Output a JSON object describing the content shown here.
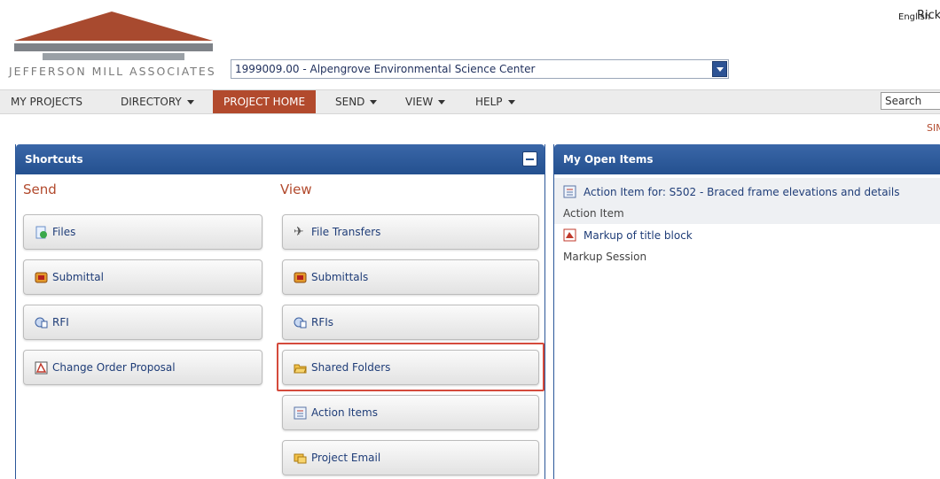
{
  "header": {
    "company_name": "JEFFERSON MILL ASSOCIATES",
    "language": "English",
    "user": "Rick",
    "project_selector": "1999009.00 - Alpengrove Environmental Science Center"
  },
  "nav": {
    "items": [
      {
        "label": "MY PROJECTS"
      },
      {
        "label": "DIRECTORY"
      },
      {
        "label": "PROJECT HOME"
      },
      {
        "label": "SEND"
      },
      {
        "label": "VIEW"
      },
      {
        "label": "HELP"
      }
    ],
    "search_value": "Search",
    "sim_link": "SIM"
  },
  "shortcuts": {
    "title": "Shortcuts",
    "send_heading": "Send",
    "view_heading": "View",
    "send_items": [
      {
        "label": "Files",
        "icon": "file-send-icon"
      },
      {
        "label": "Submittal",
        "icon": "submittal-icon"
      },
      {
        "label": "RFI",
        "icon": "rfi-icon"
      },
      {
        "label": "Change Order Proposal",
        "icon": "change-order-icon"
      }
    ],
    "view_items": [
      {
        "label": "File Transfers",
        "icon": "satellite-icon"
      },
      {
        "label": "Submittals",
        "icon": "submittal-icon"
      },
      {
        "label": "RFIs",
        "icon": "rfi-icon"
      },
      {
        "label": "Shared Folders",
        "icon": "folder-icon"
      },
      {
        "label": "Action Items",
        "icon": "action-item-icon"
      },
      {
        "label": "Project Email",
        "icon": "email-icon"
      }
    ]
  },
  "open_items": {
    "title": "My Open Items",
    "items": [
      {
        "link": "Action Item for: S502 - Braced frame elevations and details",
        "type": "Action Item",
        "icon": "action-item-icon"
      },
      {
        "link": "Markup of title block",
        "type": "Markup Session",
        "icon": "markup-icon"
      }
    ]
  },
  "colors": {
    "brand_red": "#b24a2d",
    "panel_blue": "#2b5799",
    "highlight_red": "#d44a3c"
  }
}
